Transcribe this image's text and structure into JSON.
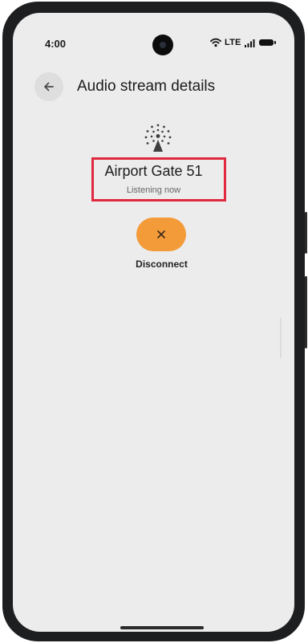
{
  "status_bar": {
    "time": "4:00",
    "network": "LTE"
  },
  "header": {
    "title": "Audio stream details"
  },
  "stream": {
    "name": "Airport Gate 51",
    "status": "Listening now"
  },
  "actions": {
    "disconnect_label": "Disconnect"
  },
  "colors": {
    "accent": "#f39a39",
    "highlight": "#e0283e",
    "screen_bg": "#ececec"
  },
  "icons": {
    "back": "arrow-left-icon",
    "broadcast": "broadcast-icon",
    "close": "close-icon"
  }
}
